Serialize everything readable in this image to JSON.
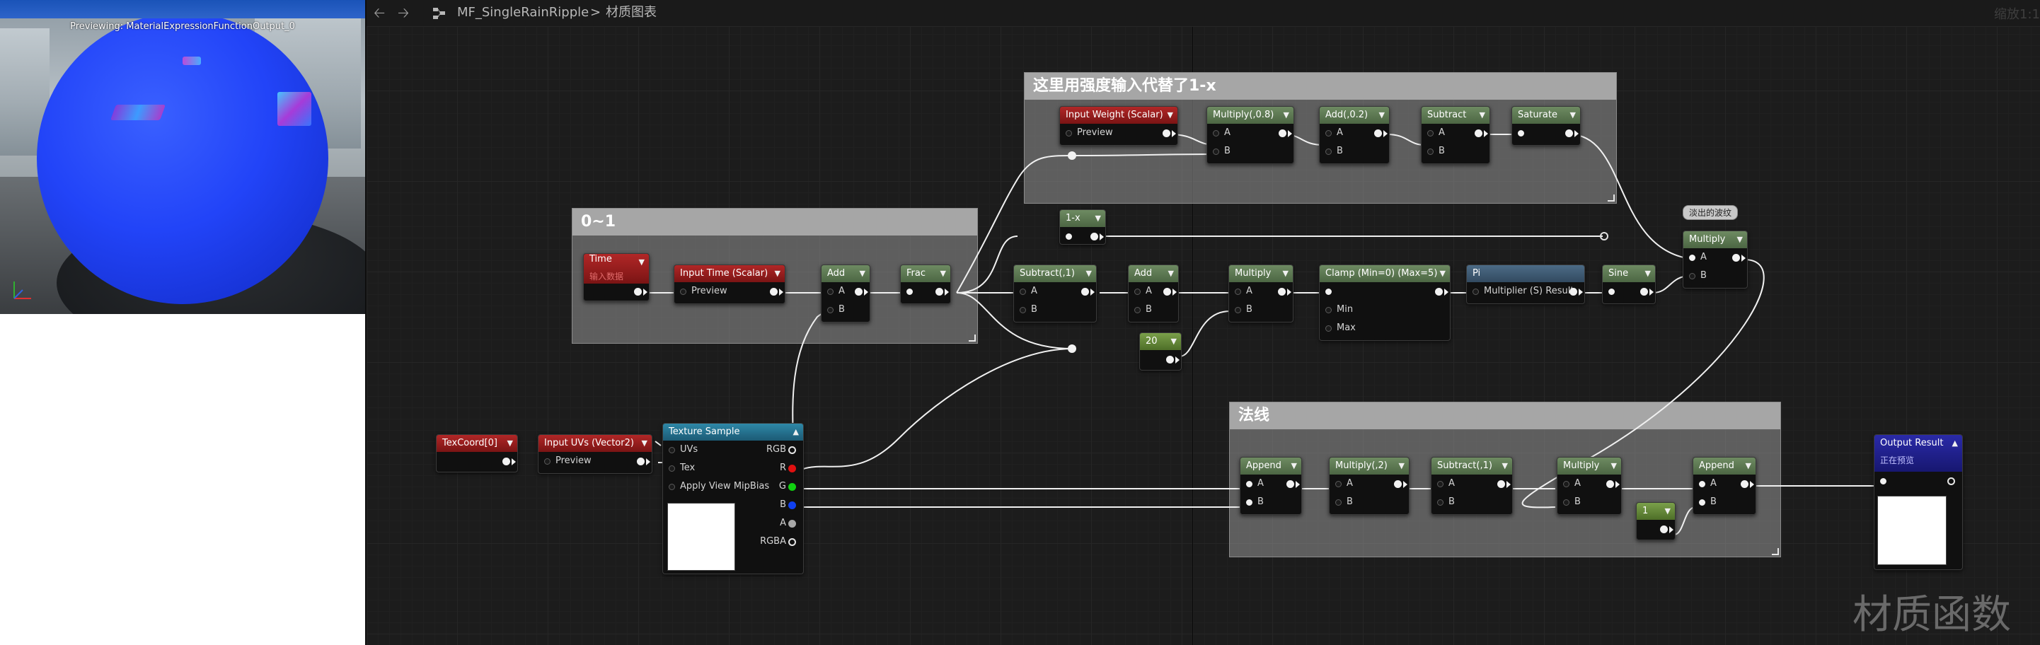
{
  "preview": {
    "title": "Previewing: MaterialExpressionFunctionOutput_0",
    "sphere_color": "#2244f8"
  },
  "toolbar": {
    "back_icon": "arrow-left-icon",
    "forward_icon": "arrow-right-icon",
    "asset_icon": "material-function-icon",
    "asset_name": "MF_SingleRainRipple",
    "separator": ">",
    "graph_name": "材质图表",
    "zoom": "缩放1:1"
  },
  "comments": {
    "strength": "这里用强度输入代替了1-x",
    "range": "0~1",
    "normal": "法线"
  },
  "nodes": {
    "input_weight": {
      "title": "Input Weight (Scalar)",
      "pin": "Preview"
    },
    "multiply_08": {
      "title": "Multiply(,0.8)",
      "a": "A",
      "b": "B"
    },
    "add_02": {
      "title": "Add(,0.2)",
      "a": "A",
      "b": "B"
    },
    "subtract_top": {
      "title": "Subtract",
      "a": "A",
      "b": "B"
    },
    "saturate": {
      "title": "Saturate"
    },
    "one_minus_x": {
      "title": "1-x"
    },
    "time": {
      "title": "Time",
      "subtitle": "输入数据"
    },
    "input_time": {
      "title": "Input Time (Scalar)",
      "pin": "Preview"
    },
    "add_range": {
      "title": "Add",
      "a": "A",
      "b": "B"
    },
    "frac": {
      "title": "Frac"
    },
    "subtract_1": {
      "title": "Subtract(,1)",
      "a": "A",
      "b": "B"
    },
    "add_mid": {
      "title": "Add",
      "a": "A",
      "b": "B"
    },
    "multiply_mid": {
      "title": "Multiply",
      "a": "A",
      "b": "B"
    },
    "clamp": {
      "title": "Clamp (Min=0) (Max=5)",
      "min": "Min",
      "max": "Max"
    },
    "pi": {
      "title": "Pi",
      "pin": "Multiplier (S) Result"
    },
    "sine": {
      "title": "Sine"
    },
    "const_20": {
      "title": "20"
    },
    "multiply_right": {
      "title": "Multiply",
      "a": "A",
      "b": "B"
    },
    "fade_badge": "淡出的波纹",
    "texcoord": {
      "title": "TexCoord[0]"
    },
    "input_uvs": {
      "title": "Input UVs (Vector2)",
      "pin": "Preview"
    },
    "texture_sample": {
      "title": "Texture Sample",
      "uvs": "UVs",
      "tex": "Tex",
      "mip": "Apply View MipBias",
      "rgb": "RGB",
      "r": "R",
      "g": "G",
      "b": "B",
      "a": "A",
      "rgba": "RGBA"
    },
    "append_1": {
      "title": "Append",
      "a": "A",
      "b": "B"
    },
    "multiply_2": {
      "title": "Multiply(,2)",
      "a": "A",
      "b": "B"
    },
    "subtract_n1": {
      "title": "Subtract(,1)",
      "a": "A",
      "b": "B"
    },
    "multiply_normal": {
      "title": "Multiply",
      "a": "A",
      "b": "B"
    },
    "const_1": {
      "title": "1"
    },
    "append_2": {
      "title": "Append",
      "a": "A",
      "b": "B"
    },
    "output_result": {
      "title": "Output Result",
      "subtitle": "正在预览"
    }
  },
  "watermark": "材质函数"
}
